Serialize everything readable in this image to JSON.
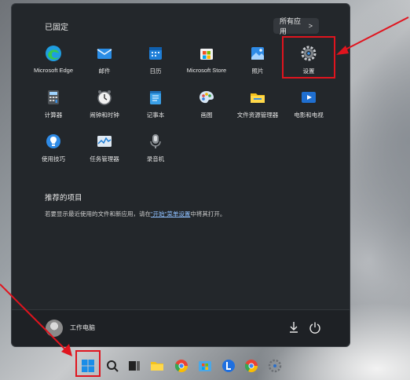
{
  "start_menu": {
    "pinned_title": "已固定",
    "all_apps_label": "所有应用",
    "all_apps_chevron": ">",
    "pinned_apps": [
      {
        "label": "Microsoft Edge",
        "icon": "edge-icon"
      },
      {
        "label": "邮件",
        "icon": "mail-icon"
      },
      {
        "label": "日历",
        "icon": "calendar-icon"
      },
      {
        "label": "Microsoft Store",
        "icon": "store-icon"
      },
      {
        "label": "照片",
        "icon": "photos-icon"
      },
      {
        "label": "设置",
        "icon": "settings-gear-icon"
      },
      {
        "label": "计算器",
        "icon": "calculator-icon"
      },
      {
        "label": "闹钟和时钟",
        "icon": "clock-icon"
      },
      {
        "label": "记事本",
        "icon": "notepad-icon"
      },
      {
        "label": "画图",
        "icon": "paint-icon"
      },
      {
        "label": "文件资源管理器",
        "icon": "file-explorer-icon"
      },
      {
        "label": "电影和电视",
        "icon": "movies-tv-icon"
      },
      {
        "label": "使用技巧",
        "icon": "tips-icon"
      },
      {
        "label": "任务管理器",
        "icon": "task-manager-icon"
      },
      {
        "label": "录音机",
        "icon": "voice-recorder-icon"
      }
    ],
    "recommended_title": "推荐的项目",
    "recommended_desc_before": "若要显示最近使用的文件和新应用，请在",
    "recommended_desc_link": "\"开始\"菜单设置",
    "recommended_desc_after": "中将其打开。",
    "user_name": "工作电脑"
  },
  "taskbar": {
    "icons": [
      "start-windows-icon",
      "search-icon",
      "task-view-icon",
      "file-explorer-icon",
      "chrome-icon",
      "store-icon",
      "browser-l-icon",
      "chrome-icon",
      "settings-gear-icon"
    ]
  },
  "colors": {
    "menu_bg": "#23272b",
    "highlight": "#e0141e",
    "accent": "#3b8ee0"
  }
}
